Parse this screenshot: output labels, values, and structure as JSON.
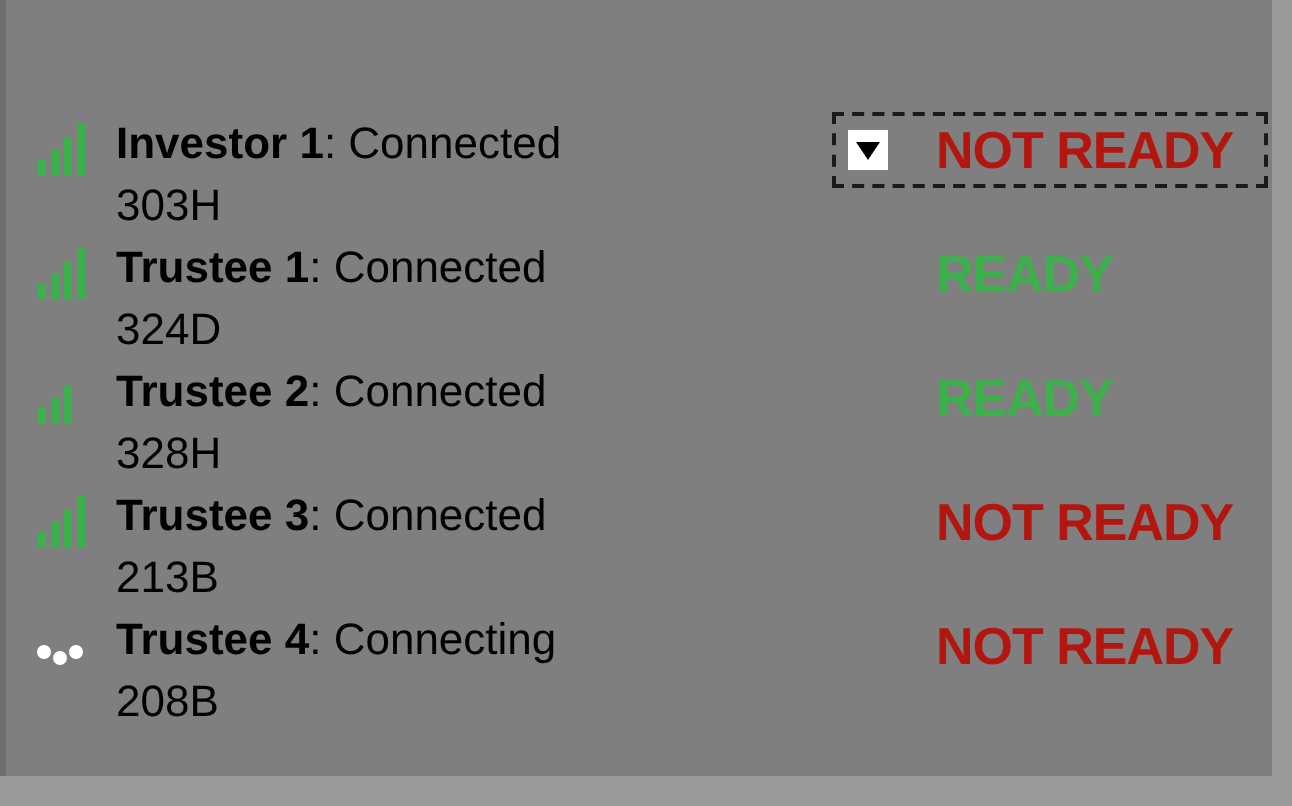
{
  "participants": [
    {
      "label": "**Investor 1**: Connected",
      "code": "303H",
      "kind": "full",
      "status": "NOT READY",
      "ready": false,
      "selected": true
    },
    {
      "label": "**Trustee 1**: Connected",
      "code": "324D",
      "kind": "full",
      "status": "READY",
      "ready": true,
      "selected": false
    },
    {
      "label": "**Trustee 2**: Connected",
      "code": "328H",
      "kind": "three",
      "status": "READY",
      "ready": true,
      "selected": false
    },
    {
      "label": "**Trustee 3**: Connected",
      "code": "213B",
      "kind": "full",
      "status": "NOT READY",
      "ready": false,
      "selected": false
    },
    {
      "label": "**Trustee 4**: Connecting",
      "code": "208B",
      "kind": "connecting",
      "status": "NOT READY",
      "ready": false,
      "selected": false
    }
  ]
}
